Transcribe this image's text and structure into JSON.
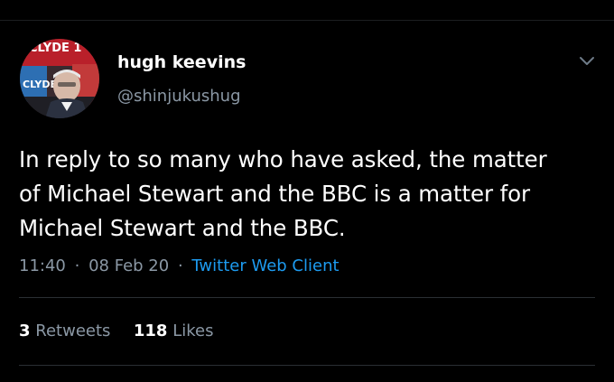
{
  "author": {
    "name": "hugh keevins",
    "handle": "@shinjukushug",
    "avatar_logo_text": "CLYDE 1",
    "avatar_logo_text_2": "CLYDE"
  },
  "tweet": {
    "lines": [
      "In reply to so many who have asked, the matter",
      "of Michael Stewart and the BBC is a matter for",
      "Michael Stewart and the BBC."
    ],
    "time": "11:40",
    "date": "08 Feb 20",
    "separator": "·",
    "client": "Twitter Web Client"
  },
  "stats": {
    "retweets_count": "3",
    "retweets_label": "Retweets",
    "likes_count": "118",
    "likes_label": "Likes"
  },
  "icons": {
    "menu": "chevron-down-icon"
  },
  "colors": {
    "background": "#000000",
    "text": "#ffffff",
    "secondary": "#8b98a5",
    "link": "#1d9bf0"
  }
}
